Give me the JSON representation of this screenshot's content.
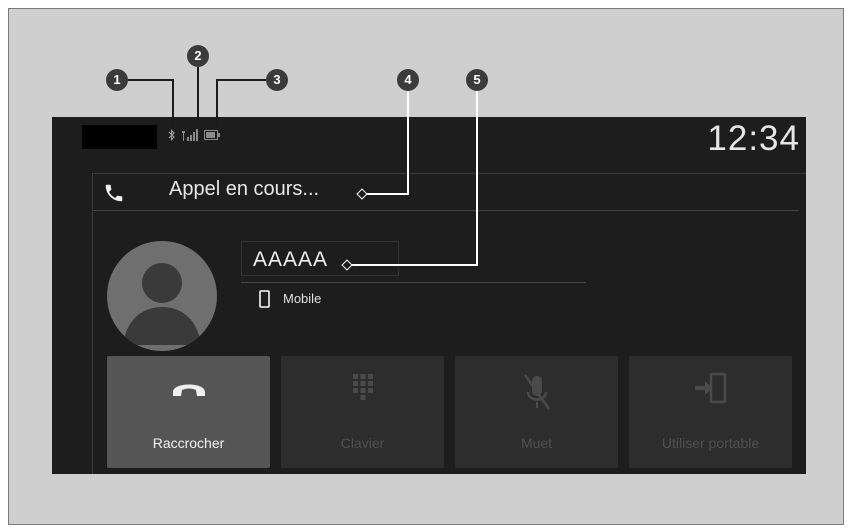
{
  "status_bar": {
    "time": "12:34",
    "icons": [
      "bluetooth-icon",
      "signal-strength-icon",
      "battery-icon"
    ]
  },
  "call": {
    "status_text": "Appel en cours...",
    "contact_name": "AAAAA",
    "phone_type": "Mobile"
  },
  "buttons": [
    {
      "label": "Raccrocher",
      "icon": "hang-up-icon",
      "enabled": true
    },
    {
      "label": "Clavier",
      "icon": "keypad-icon",
      "enabled": false
    },
    {
      "label": "Muet",
      "icon": "mute-microphone-icon",
      "enabled": false
    },
    {
      "label": "Utiliser portable",
      "icon": "transfer-to-phone-icon",
      "enabled": false
    }
  ],
  "callouts": [
    "1",
    "2",
    "3",
    "4",
    "5"
  ],
  "colors": {
    "screen_background": "#1d1d1d",
    "page_background": "#cfcfcf",
    "active_button": "#555555",
    "disabled_button": "#2d2d2d"
  }
}
